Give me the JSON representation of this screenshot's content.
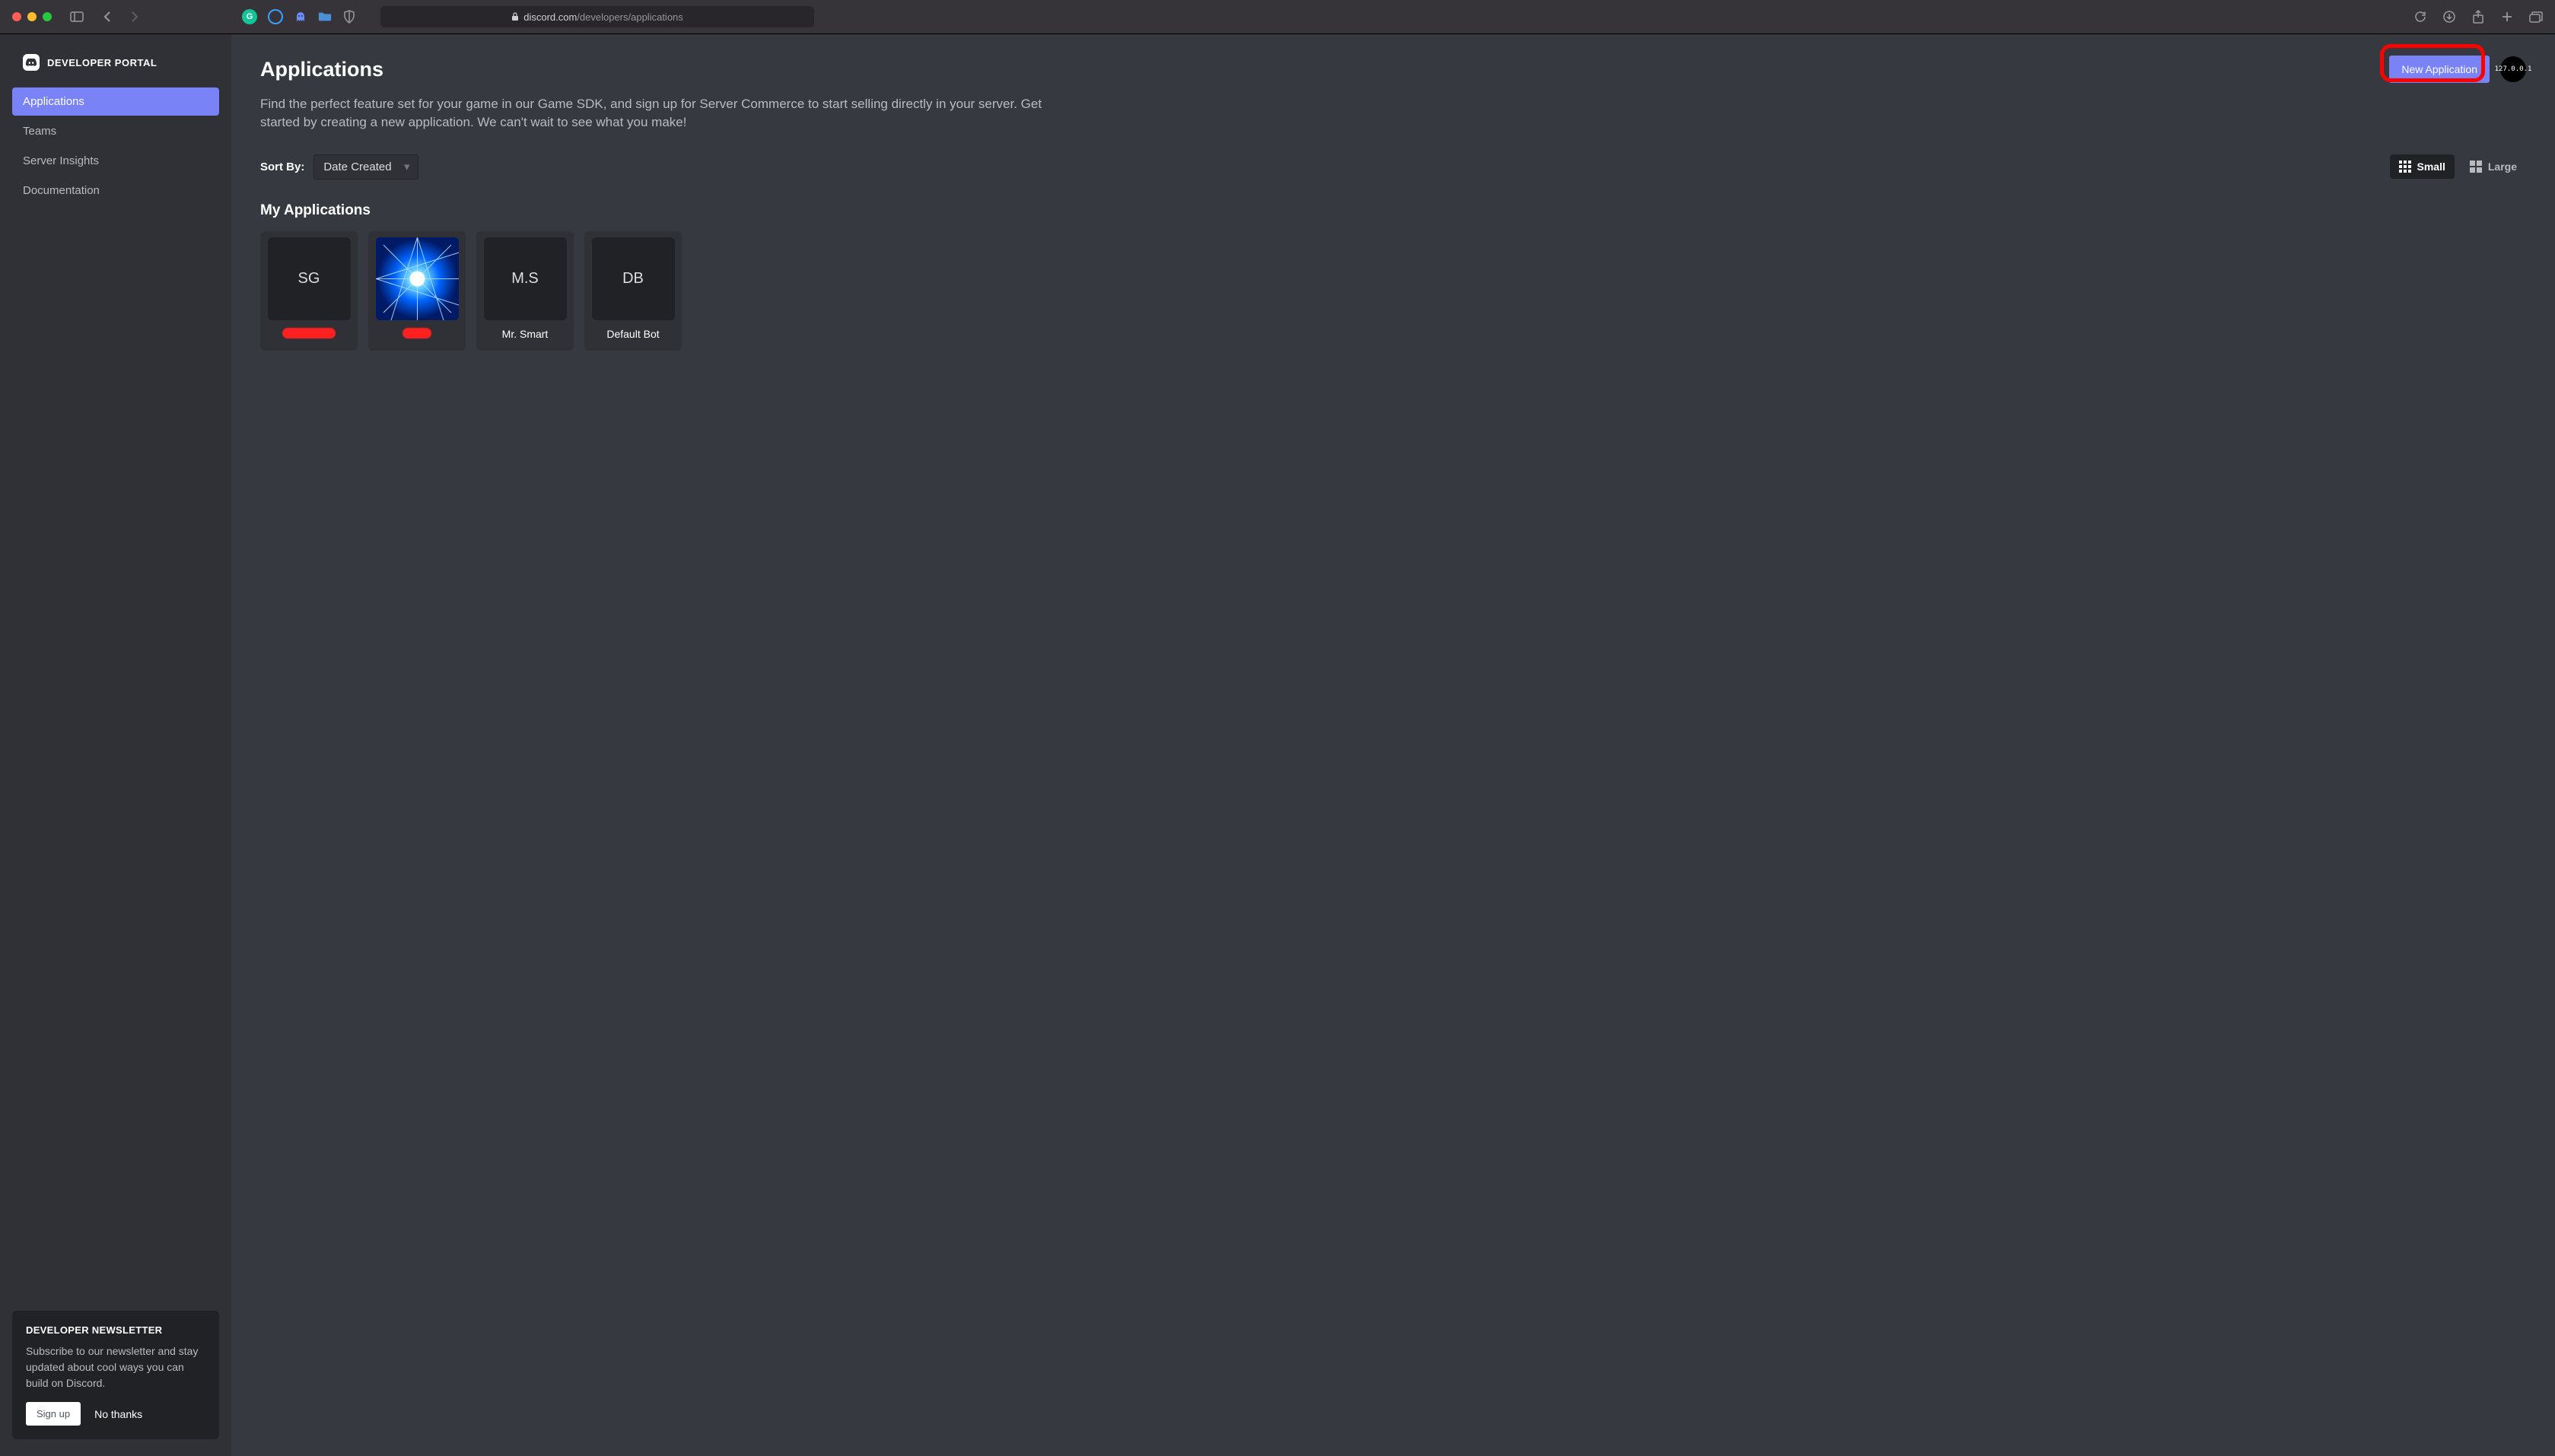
{
  "browser": {
    "url_host": "discord.com",
    "url_path": "/developers/applications"
  },
  "sidebar": {
    "brand": "DEVELOPER PORTAL",
    "items": [
      {
        "label": "Applications",
        "active": true
      },
      {
        "label": "Teams",
        "active": false
      },
      {
        "label": "Server Insights",
        "active": false
      },
      {
        "label": "Documentation",
        "active": false
      }
    ]
  },
  "newsletter": {
    "title": "DEVELOPER NEWSLETTER",
    "body": "Subscribe to our newsletter and stay updated about cool ways you can build on Discord.",
    "signup_label": "Sign up",
    "dismiss_label": "No thanks"
  },
  "header": {
    "title": "Applications",
    "new_button": "New Application",
    "avatar_text": "127.0.0.1"
  },
  "intro_text": "Find the perfect feature set for your game in our Game SDK, and sign up for Server Commerce to start selling directly in your server. Get started by creating a new application. We can't wait to see what you make!",
  "sort": {
    "label": "Sort By:",
    "selected": "Date Created"
  },
  "view": {
    "small_label": "Small",
    "large_label": "Large"
  },
  "section_heading": "My Applications",
  "applications": [
    {
      "initials": "SG",
      "name": "",
      "redacted": true,
      "image": false
    },
    {
      "initials": "",
      "name": "",
      "redacted": true,
      "image": true,
      "redact_small": true
    },
    {
      "initials": "M.S",
      "name": "Mr. Smart",
      "redacted": false,
      "image": false
    },
    {
      "initials": "DB",
      "name": "Default Bot",
      "redacted": false,
      "image": false
    }
  ]
}
